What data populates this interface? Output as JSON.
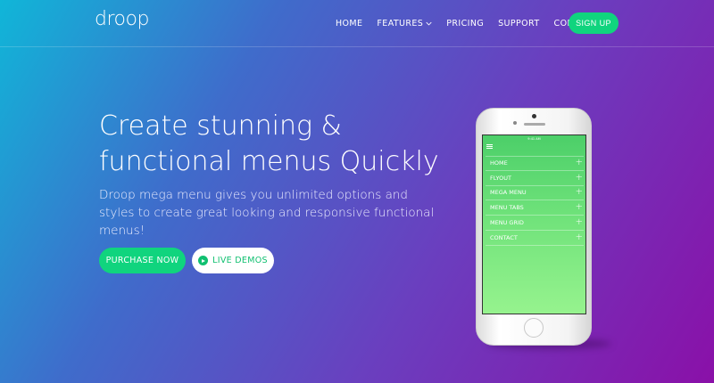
{
  "header": {
    "logo": "droop",
    "nav": [
      {
        "label": "HOME"
      },
      {
        "label": "FEATURES",
        "has_dropdown": true
      },
      {
        "label": "PRICING"
      },
      {
        "label": "SUPPORT"
      },
      {
        "label": "CONTACT"
      }
    ],
    "signup_label": "SIGN UP"
  },
  "hero": {
    "title_line1": "Create stunning &",
    "title_line2": "functional menus Quickly",
    "description": "Droop mega menu gives you unlimited options and styles to create great looking and responsive functional menus!",
    "purchase_label": "PURCHASE NOW",
    "live_demos_label": "LIVE DEMOS"
  },
  "phone": {
    "status_time": "9:41 AM",
    "menu": [
      {
        "label": "HOME"
      },
      {
        "label": "FLYOUT"
      },
      {
        "label": "MEGA MENU"
      },
      {
        "label": "MENU TABS"
      },
      {
        "label": "MENU GRID"
      },
      {
        "label": "CONTACT"
      }
    ]
  },
  "colors": {
    "accent_green": "#10d47e",
    "gradient_start": "#10b6d8",
    "gradient_end": "#8a10a8"
  }
}
